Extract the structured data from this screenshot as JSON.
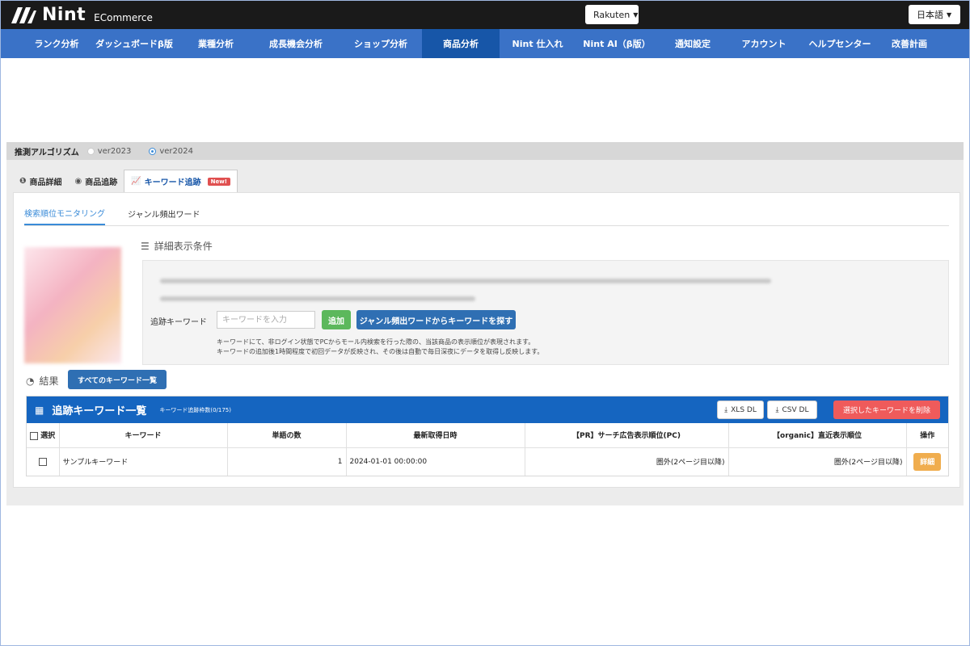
{
  "brand": {
    "name": "Nint",
    "sub": "ECommerce"
  },
  "header": {
    "mall": "Rakuten",
    "language": "日本語"
  },
  "nav": {
    "items": [
      {
        "label": "ランク分析"
      },
      {
        "label": "ダッシュボードβ版"
      },
      {
        "label": "業種分析"
      },
      {
        "label": "成長機会分析"
      },
      {
        "label": "ショップ分析"
      },
      {
        "label": "商品分析",
        "active": true
      },
      {
        "label": "Nint 仕入れ"
      },
      {
        "label": "Nint AI（β版）"
      },
      {
        "label": "通知設定"
      },
      {
        "label": "アカウント"
      },
      {
        "label": "ヘルプセンター"
      },
      {
        "label": "改善計画"
      }
    ]
  },
  "algorithm": {
    "title": "推測アルゴリズム",
    "options": [
      {
        "label": "ver2023",
        "selected": false
      },
      {
        "label": "ver2024",
        "selected": true
      }
    ]
  },
  "tabs": {
    "detail": "商品詳細",
    "track": "商品追跡",
    "keyword": "キーワード追跡",
    "new_badge": "New!"
  },
  "subtabs": {
    "monitoring": "検索順位モニタリング",
    "genre": "ジャンル頻出ワード"
  },
  "conditions": {
    "title": "詳細表示条件",
    "keyword_label": "追跡キーワード",
    "keyword_placeholder": "キーワードを入力",
    "add_button": "追加",
    "genre_button": "ジャンル頻出ワードからキーワードを探す",
    "note1": "キーワードにて、非ログイン状態でPCからモール内検索を行った際の、当該商品の表示順位が表現されます。",
    "note2": "キーワードの追加後1時間程度で初回データが反映され、その後は自動で毎日深夜にデータを取得し反映します。"
  },
  "result": {
    "title": "結果",
    "all_keywords_button": "すべてのキーワード一覧"
  },
  "panel": {
    "title": "追跡キーワード一覧",
    "count_label": "キーワード追跡枠数(0/175)",
    "xls_button": "XLS DL",
    "csv_button": "CSV DL",
    "delete_button": "選択したキーワードを削除"
  },
  "table": {
    "headers": [
      "選択",
      "キーワード",
      "単語の数",
      "最新取得日時",
      "【PR】サーチ広告表示順位(PC)",
      "【organic】直近表示順位",
      "操作"
    ],
    "rows": [
      {
        "keyword": "サンプルキーワード",
        "word_count": "1",
        "datetime": "2024-01-01 00:00:00",
        "pr_rank": "圏外(2ページ目以降)",
        "organic_rank": "圏外(2ページ目以降)",
        "action": "詳細"
      }
    ]
  },
  "colors": {
    "nav": "#3a72c7",
    "nav_active": "#1756a8",
    "panel_head": "#1565c0",
    "delete": "#ef5b5b",
    "detail": "#f0ad4e",
    "add": "#5cb85c"
  }
}
